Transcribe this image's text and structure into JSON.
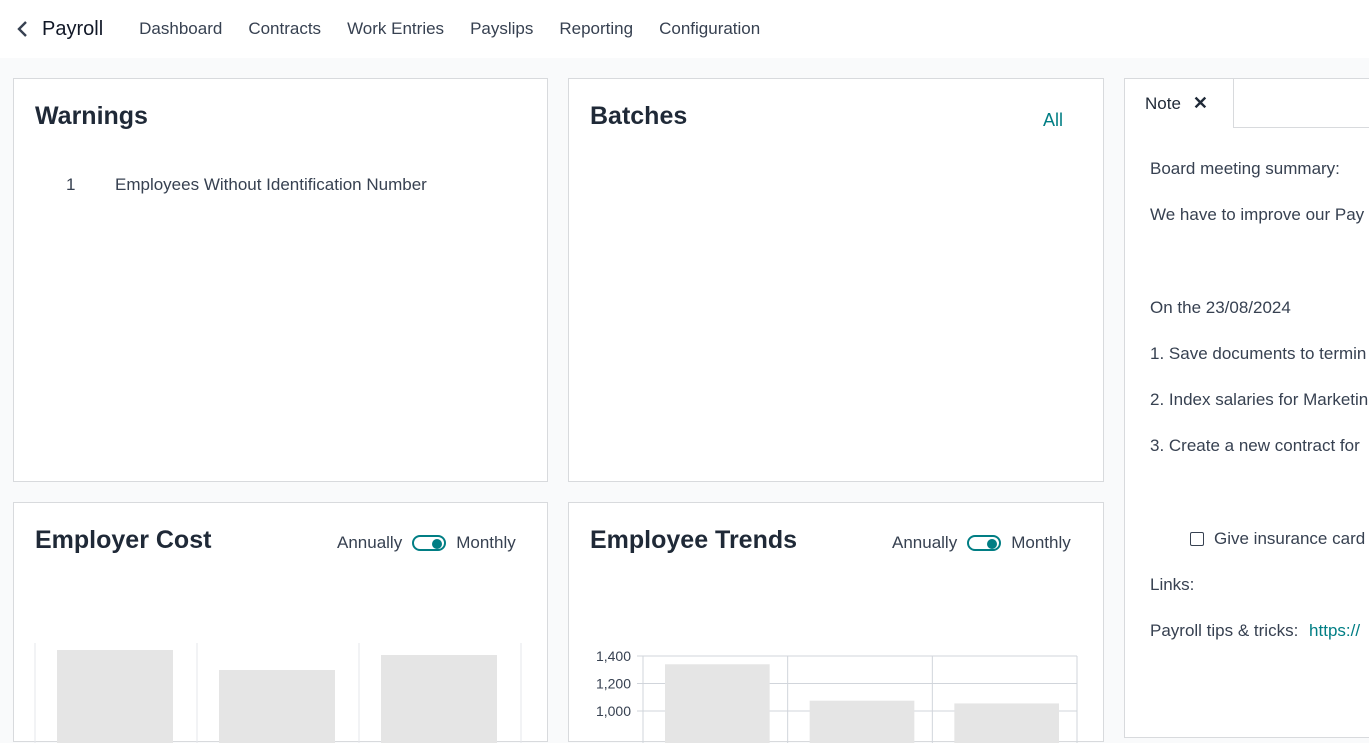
{
  "topbar": {
    "app_name": "Payroll",
    "menu": [
      "Dashboard",
      "Contracts",
      "Work Entries",
      "Payslips",
      "Reporting",
      "Configuration"
    ]
  },
  "warnings": {
    "title": "Warnings",
    "items": [
      {
        "count": "1",
        "label": "Employees Without Identification Number"
      }
    ]
  },
  "batches": {
    "title": "Batches",
    "all_label": "All"
  },
  "employer_cost": {
    "title": "Employer Cost",
    "toggle_left": "Annually",
    "toggle_right": "Monthly",
    "toggle_state": "Monthly"
  },
  "employee_trends": {
    "title": "Employee Trends",
    "toggle_left": "Annually",
    "toggle_right": "Monthly",
    "toggle_state": "Monthly"
  },
  "note": {
    "tab_label": "Note",
    "lines": [
      "Board meeting summary:",
      "We have to improve our Pay",
      "On the 23/08/2024",
      "1. Save documents to termin",
      "2. Index salaries for Marketin",
      "3. Create a new contract for",
      "Give insurance card",
      "Links:",
      "Payroll tips & tricks:"
    ],
    "link_text": "https://"
  },
  "colors": {
    "accent": "#017e84",
    "bar": "#e5e5e5",
    "border": "#d8dadd"
  },
  "chart_data": [
    {
      "type": "bar",
      "title": "Employer Cost",
      "categories": [
        "",
        "",
        ""
      ],
      "values": [
        null,
        null,
        null
      ],
      "note": "placeholder bars, no labels visible"
    },
    {
      "type": "bar",
      "title": "Employee Trends",
      "categories": [
        "",
        "",
        ""
      ],
      "values": [
        1340,
        1075,
        1055
      ],
      "ylim": [
        1000,
        1400
      ],
      "yticks": [
        "1,400",
        "1,200",
        "1,000"
      ]
    }
  ]
}
